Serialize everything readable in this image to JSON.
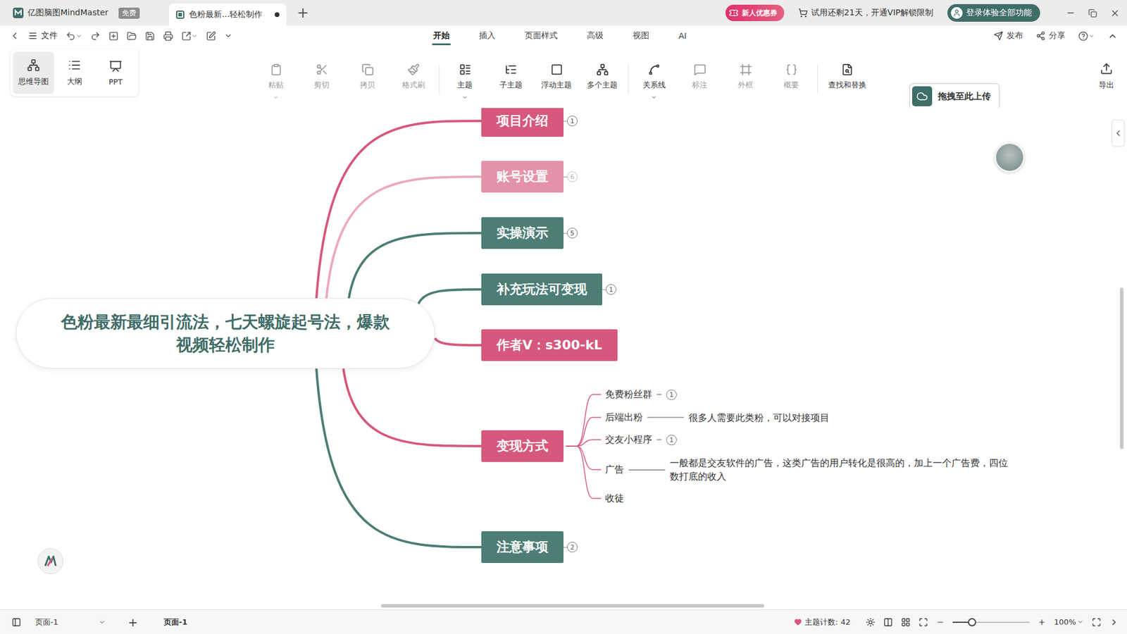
{
  "window": {
    "app_name": "亿图脑图MindMaster",
    "app_badge": "免费",
    "tabs": [
      {
        "label": "色粉最新...轻松制作",
        "selected": true,
        "unsaved": true
      }
    ],
    "new_tab": "+",
    "coupon": "新人优惠券",
    "trial": "试用还剩21天，开通VIP解锁限制",
    "login": "登录体验全部功能"
  },
  "menu": {
    "file": "文件",
    "tabs": [
      {
        "label": "开始",
        "selected": true
      },
      {
        "label": "插入",
        "selected": false
      },
      {
        "label": "页面样式",
        "selected": false
      },
      {
        "label": "高级",
        "selected": false
      },
      {
        "label": "视图",
        "selected": false
      },
      {
        "label": "AI",
        "selected": false
      }
    ],
    "actions": [
      "发布",
      "分享"
    ]
  },
  "toolbar": {
    "views": [
      {
        "label": "思维导图",
        "selected": true
      },
      {
        "label": "大纲",
        "selected": false
      },
      {
        "label": "PPT",
        "selected": false
      }
    ],
    "tools": [
      {
        "label": "粘贴",
        "disabled": true,
        "dropdown": true
      },
      {
        "label": "剪切",
        "disabled": true,
        "dropdown": false
      },
      {
        "label": "拷贝",
        "disabled": true,
        "dropdown": false
      },
      {
        "label": "格式刷",
        "disabled": true,
        "dropdown": false
      },
      {
        "label": "主题",
        "disabled": false,
        "dropdown": true
      },
      {
        "label": "子主题",
        "disabled": false,
        "dropdown": false
      },
      {
        "label": "浮动主题",
        "disabled": false,
        "dropdown": false
      },
      {
        "label": "多个主题",
        "disabled": false,
        "dropdown": false
      },
      {
        "label": "关系线",
        "disabled": false,
        "dropdown": true
      },
      {
        "label": "标注",
        "disabled": true,
        "dropdown": false
      },
      {
        "label": "外框",
        "disabled": true,
        "dropdown": false
      },
      {
        "label": "概要",
        "disabled": true,
        "dropdown": false
      },
      {
        "label": "查找和替换",
        "disabled": false,
        "dropdown": false
      }
    ],
    "upload": "拖拽至此上传",
    "export": "导出"
  },
  "mindmap": {
    "central": [
      "色粉最新最细引流法，七天螺旋起号法，爆款",
      "视频轻松制作"
    ],
    "branches": [
      {
        "label": "项目介绍",
        "color": "#d6587c",
        "badge": "1",
        "dimmed": false
      },
      {
        "label": "账号设置",
        "color": "#d6587c",
        "badge": "6",
        "dimmed": true
      },
      {
        "label": "实操演示",
        "color": "#4d7d75",
        "badge": "5",
        "dimmed": false
      },
      {
        "label": "补充玩法可变现",
        "color": "#4d7d75",
        "badge": "1",
        "dimmed": false
      },
      {
        "label": "作者V：s300-kL",
        "color": "#d6587c",
        "dimmed": false
      },
      {
        "label": "变现方式",
        "color": "#d6587c",
        "dimmed": false,
        "children": [
          {
            "label": "免费粉丝群",
            "badge": "1"
          },
          {
            "label": "后端出粉",
            "note": [
              "很多人需要此类粉，可以对接项目"
            ]
          },
          {
            "label": "交友小程序",
            "badge": "1"
          },
          {
            "label": "广告",
            "note": [
              "一般都是交友软件的广告，这类广告的用户转化是很高的，加上一个广告费，四位",
              "数打底的收入"
            ]
          },
          {
            "label": "收徒"
          }
        ]
      },
      {
        "label": "注意事项",
        "color": "#4d7d75",
        "badge": "2",
        "dimmed": false
      }
    ]
  },
  "status_bar": {
    "page_select": "页面-1",
    "add": "+",
    "pages": [
      {
        "label": "页面-1",
        "selected": true
      }
    ],
    "topic_count_label": "主题计数:",
    "topic_count": "42",
    "zoom_level": 0.25,
    "zoom": "100%"
  }
}
